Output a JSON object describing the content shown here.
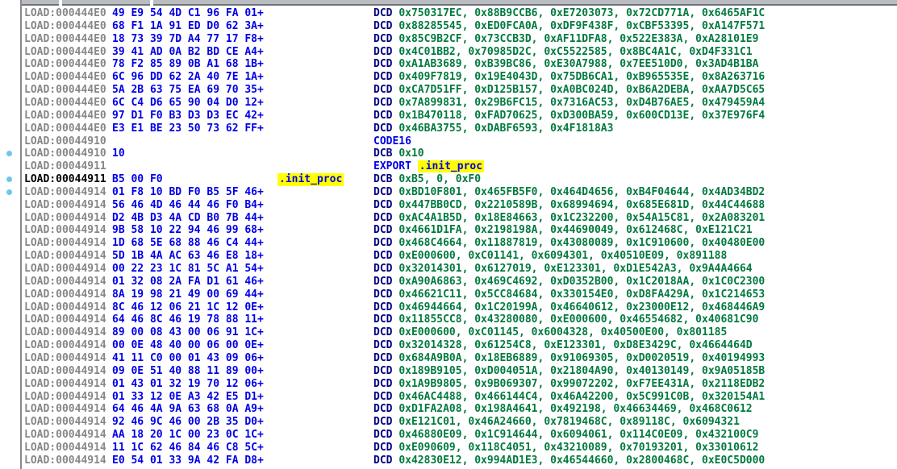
{
  "colors": {
    "background": "#ffffff",
    "address_gray": "#878787",
    "address_current": "#000000",
    "bytes_blue": "#0000e8",
    "mnemonic_navy": "#000080",
    "keyword_blue": "#0000e8",
    "number_green": "#007a3e",
    "highlight_bg": "#ffff00",
    "highlight_text": "#0000e8",
    "bullet_blue": "#6ec6ee",
    "top_strip": "#b9bdc1",
    "gutter_border": "#898b8d"
  },
  "export_symbol": ".init_proc",
  "lines": [
    {
      "address": "LOAD:000444E0",
      "bytes": "49 E9 54 4D C1 96 FA 01+",
      "label": "",
      "mnemonic": "DCD",
      "mnemonic_style": "directive",
      "operands": "0x750317EC, 0x88B9CCB6, 0xE7203073, 0x72CD771A, 0x6465AF1C",
      "operand_style": "number",
      "bullet": false,
      "current": false
    },
    {
      "address": "LOAD:000444E0",
      "bytes": "68 F1 1A 91 ED D0 62 3A+",
      "label": "",
      "mnemonic": "DCD",
      "mnemonic_style": "directive",
      "operands": "0x88285545, 0xED0FCA0A, 0xDF9F438F, 0xCBF53395, 0xA147F571",
      "operand_style": "number",
      "bullet": false,
      "current": false
    },
    {
      "address": "LOAD:000444E0",
      "bytes": "18 73 39 7D A4 77 17 F8+",
      "label": "",
      "mnemonic": "DCD",
      "mnemonic_style": "directive",
      "operands": "0x85C9B2CF, 0x73CCB3D, 0xAF11DFA8, 0x522E383A, 0xA28101E9",
      "operand_style": "number",
      "bullet": false,
      "current": false
    },
    {
      "address": "LOAD:000444E0",
      "bytes": "39 41 AD 0A B2 BD CE A4+",
      "label": "",
      "mnemonic": "DCD",
      "mnemonic_style": "directive",
      "operands": "0x4C01BB2, 0x70985D2C, 0xC5522585, 0x8BC4A1C, 0xD4F331C1",
      "operand_style": "number",
      "bullet": false,
      "current": false
    },
    {
      "address": "LOAD:000444E0",
      "bytes": "78 F2 85 89 0B A1 68 1B+",
      "label": "",
      "mnemonic": "DCD",
      "mnemonic_style": "directive",
      "operands": "0xA1AB3689, 0xB39BC86, 0xE30A7988, 0x7EE510D0, 0x3AD4B1BA",
      "operand_style": "number",
      "bullet": false,
      "current": false
    },
    {
      "address": "LOAD:000444E0",
      "bytes": "6C 96 DD 62 2A 40 7E 1A+",
      "label": "",
      "mnemonic": "DCD",
      "mnemonic_style": "directive",
      "operands": "0x409F7819, 0x19E4043D, 0x75DB6CA1, 0xB965535E, 0x8A263716",
      "operand_style": "number",
      "bullet": false,
      "current": false
    },
    {
      "address": "LOAD:000444E0",
      "bytes": "5A 2B 63 75 EA 69 70 35+",
      "label": "",
      "mnemonic": "DCD",
      "mnemonic_style": "directive",
      "operands": "0xCA7D51FF, 0xD125B157, 0xA0BC024D, 0xB6A2DEBA, 0xAA7D5C65",
      "operand_style": "number",
      "bullet": false,
      "current": false
    },
    {
      "address": "LOAD:000444E0",
      "bytes": "6C C4 D6 65 90 04 D0 12+",
      "label": "",
      "mnemonic": "DCD",
      "mnemonic_style": "directive",
      "operands": "0x7A899831, 0x29B6FC15, 0x7316AC53, 0xD4B76AE5, 0x479459A4",
      "operand_style": "number",
      "bullet": false,
      "current": false
    },
    {
      "address": "LOAD:000444E0",
      "bytes": "97 D1 F0 B3 D3 D3 EC 42+",
      "label": "",
      "mnemonic": "DCD",
      "mnemonic_style": "directive",
      "operands": "0x1B470118, 0xFAD70625, 0xD300BA59, 0x600CD13E, 0x37E976F4",
      "operand_style": "number",
      "bullet": false,
      "current": false
    },
    {
      "address": "LOAD:000444E0",
      "bytes": "E3 E1 BE 23 50 73 62 FF+",
      "label": "",
      "mnemonic": "DCD",
      "mnemonic_style": "directive",
      "operands": "0x46BA3755, 0xDABF6593, 0x4F1818A3",
      "operand_style": "number",
      "bullet": false,
      "current": false
    },
    {
      "address": "LOAD:00044910",
      "bytes": "",
      "label": "",
      "mnemonic": "CODE16",
      "mnemonic_style": "keyword",
      "operands": "",
      "operand_style": null,
      "bullet": false,
      "current": false
    },
    {
      "address": "LOAD:00044910",
      "bytes": "10",
      "label": "",
      "mnemonic": "DCB",
      "mnemonic_style": "directive",
      "operands": "0x10",
      "operand_style": "number",
      "bullet": true,
      "current": false
    },
    {
      "address": "LOAD:00044911",
      "bytes": "",
      "label": "",
      "mnemonic": "EXPORT",
      "mnemonic_style": "keyword",
      "operands": ".init_proc",
      "operand_style": "symbol",
      "bullet": false,
      "current": false
    },
    {
      "address": "LOAD:00044911",
      "bytes": "B5 00 F0",
      "label": ".init_proc",
      "mnemonic": "DCB",
      "mnemonic_style": "directive",
      "operands": "0xB5, 0, 0xF0",
      "operand_style": "number",
      "bullet": true,
      "current": true
    },
    {
      "address": "LOAD:00044914",
      "bytes": "01 F8 10 BD F0 B5 5F 46+",
      "label": "",
      "mnemonic": "DCD",
      "mnemonic_style": "directive",
      "operands": "0xBD10F801, 0x465FB5F0, 0x464D4656, 0xB4F04644, 0x4AD34BD2",
      "operand_style": "number",
      "bullet": true,
      "current": false
    },
    {
      "address": "LOAD:00044914",
      "bytes": "56 46 4D 46 44 46 F0 B4+",
      "label": "",
      "mnemonic": "DCD",
      "mnemonic_style": "directive",
      "operands": "0x447BB0CD, 0x2210589B, 0x68994694, 0x685E681D, 0x44C44688",
      "operand_style": "number",
      "bullet": false,
      "current": false
    },
    {
      "address": "LOAD:00044914",
      "bytes": "D2 4B D3 4A CD B0 7B 44+",
      "label": "",
      "mnemonic": "DCD",
      "mnemonic_style": "directive",
      "operands": "0xAC4A1B5D, 0x18E84663, 0x1C232200, 0x54A15C81, 0x2A083201",
      "operand_style": "number",
      "bullet": false,
      "current": false
    },
    {
      "address": "LOAD:00044914",
      "bytes": "9B 58 10 22 94 46 99 68+",
      "label": "",
      "mnemonic": "DCD",
      "mnemonic_style": "directive",
      "operands": "0x4661D1FA, 0x2198198A, 0x44690049, 0x612468C, 0xE121C21",
      "operand_style": "number",
      "bullet": false,
      "current": false
    },
    {
      "address": "LOAD:00044914",
      "bytes": "1D 68 5E 68 88 46 C4 44+",
      "label": "",
      "mnemonic": "DCD",
      "mnemonic_style": "directive",
      "operands": "0x468C4664, 0x11887819, 0x43080089, 0x1C910600, 0x40480E00",
      "operand_style": "number",
      "bullet": false,
      "current": false
    },
    {
      "address": "LOAD:00044914",
      "bytes": "5D 1B 4A AC 63 46 E8 18+",
      "label": "",
      "mnemonic": "DCD",
      "mnemonic_style": "directive",
      "operands": "0xE000600, 0xC01141, 0x6094301, 0x40510E09, 0x891188",
      "operand_style": "number",
      "bullet": false,
      "current": false
    },
    {
      "address": "LOAD:00044914",
      "bytes": "00 22 23 1C 81 5C A1 54+",
      "label": "",
      "mnemonic": "DCD",
      "mnemonic_style": "directive",
      "operands": "0x32014301, 0x6127019, 0xE123301, 0xD1E542A3, 0x9A4A4664",
      "operand_style": "number",
      "bullet": false,
      "current": false
    },
    {
      "address": "LOAD:00044914",
      "bytes": "01 32 08 2A FA D1 61 46+",
      "label": "",
      "mnemonic": "DCD",
      "mnemonic_style": "directive",
      "operands": "0xA90A6863, 0x469C4692, 0xD0352B00, 0x1C2018AA, 0x1C0C2300",
      "operand_style": "number",
      "bullet": false,
      "current": false
    },
    {
      "address": "LOAD:00044914",
      "bytes": "8A 19 98 21 49 00 69 44+",
      "label": "",
      "mnemonic": "DCD",
      "mnemonic_style": "directive",
      "operands": "0x46621C11, 0x5CC84684, 0x330154E0, 0xD8FA429A, 0x1C214653",
      "operand_style": "number",
      "bullet": false,
      "current": false
    },
    {
      "address": "LOAD:00044914",
      "bytes": "8C 46 12 06 21 1C 12 0E+",
      "label": "",
      "mnemonic": "DCD",
      "mnemonic_style": "directive",
      "operands": "0x46944664, 0x1C20199A, 0x46640612, 0x23000E12, 0x468446A9",
      "operand_style": "number",
      "bullet": false,
      "current": false
    },
    {
      "address": "LOAD:00044914",
      "bytes": "64 46 8C 46 19 78 88 11+",
      "label": "",
      "mnemonic": "DCD",
      "mnemonic_style": "directive",
      "operands": "0x11855CC8, 0x43280080, 0xE000600, 0x46554682, 0x40681C90",
      "operand_style": "number",
      "bullet": false,
      "current": false
    },
    {
      "address": "LOAD:00044914",
      "bytes": "89 00 08 43 00 06 91 1C+",
      "label": "",
      "mnemonic": "DCD",
      "mnemonic_style": "directive",
      "operands": "0xE000600, 0xC01145, 0x6004328, 0x40500E00, 0x801185",
      "operand_style": "number",
      "bullet": false,
      "current": false
    },
    {
      "address": "LOAD:00044914",
      "bytes": "00 0E 48 40 00 06 00 0E+",
      "label": "",
      "mnemonic": "DCD",
      "mnemonic_style": "directive",
      "operands": "0x32014328, 0x61254C8, 0xE123301, 0xD8E3429C, 0x4664464D",
      "operand_style": "number",
      "bullet": false,
      "current": false
    },
    {
      "address": "LOAD:00044914",
      "bytes": "41 11 C0 00 01 43 09 06+",
      "label": "",
      "mnemonic": "DCD",
      "mnemonic_style": "directive",
      "operands": "0x684A9B0A, 0x18EB6889, 0x91069305, 0xD0020519, 0x40194993",
      "operand_style": "number",
      "bullet": false,
      "current": false
    },
    {
      "address": "LOAD:00044914",
      "bytes": "09 0E 51 40 88 11 89 00+",
      "label": "",
      "mnemonic": "DCD",
      "mnemonic_style": "directive",
      "operands": "0x189B9105, 0xD004051A, 0x21804A90, 0x40130149, 0x9A05185B",
      "operand_style": "number",
      "bullet": false,
      "current": false
    },
    {
      "address": "LOAD:00044914",
      "bytes": "01 43 01 32 19 70 12 06+",
      "label": "",
      "mnemonic": "DCD",
      "mnemonic_style": "directive",
      "operands": "0x1A9B9805, 0x9B069307, 0x99072202, 0xF7EE431A, 0x2118EDB2",
      "operand_style": "number",
      "bullet": false,
      "current": false
    },
    {
      "address": "LOAD:00044914",
      "bytes": "01 33 12 0E A3 42 E5 D1+",
      "label": "",
      "mnemonic": "DCD",
      "mnemonic_style": "directive",
      "operands": "0x46AC4488, 0x466144C4, 0x46A42200, 0x5C991C0B, 0x320154A1",
      "operand_style": "number",
      "bullet": false,
      "current": false
    },
    {
      "address": "LOAD:00044914",
      "bytes": "64 46 4A 9A 63 68 0A A9+",
      "label": "",
      "mnemonic": "DCD",
      "mnemonic_style": "directive",
      "operands": "0xD1FA2A08, 0x198A4641, 0x492198, 0x46634469, 0x468C0612",
      "operand_style": "number",
      "bullet": false,
      "current": false
    },
    {
      "address": "LOAD:00044914",
      "bytes": "92 46 9C 46 00 2B 35 D0+",
      "label": "",
      "mnemonic": "DCD",
      "mnemonic_style": "directive",
      "operands": "0xE121C01, 0x46A24660, 0x7819468C, 0x89118C, 0x6094321",
      "operand_style": "number",
      "bullet": false,
      "current": false
    },
    {
      "address": "LOAD:00044914",
      "bytes": "AA 18 20 1C 00 23 0C 1C+",
      "label": "",
      "mnemonic": "DCD",
      "mnemonic_style": "directive",
      "operands": "0x46880E09, 0x1C914644, 0x6094061, 0x114C0E09, 0x432100C9",
      "operand_style": "number",
      "bullet": false,
      "current": false
    },
    {
      "address": "LOAD:00044914",
      "bytes": "11 1C 62 46 84 46 C8 5C+",
      "label": "",
      "mnemonic": "DCD",
      "mnemonic_style": "directive",
      "operands": "0xE090609, 0x118C4051, 0x43210089, 0x70193201, 0x33010612",
      "operand_style": "number",
      "bullet": false,
      "current": false
    },
    {
      "address": "LOAD:00044914",
      "bytes": "E0 54 01 33 9A 42 FA D8+",
      "label": "",
      "mnemonic": "DCD",
      "mnemonic_style": "directive",
      "operands": "0x42830E12, 0x994AD1E3, 0x46544660, 0x2800468C, 0xE0C5D000",
      "operand_style": "number",
      "bullet": false,
      "current": false
    }
  ]
}
